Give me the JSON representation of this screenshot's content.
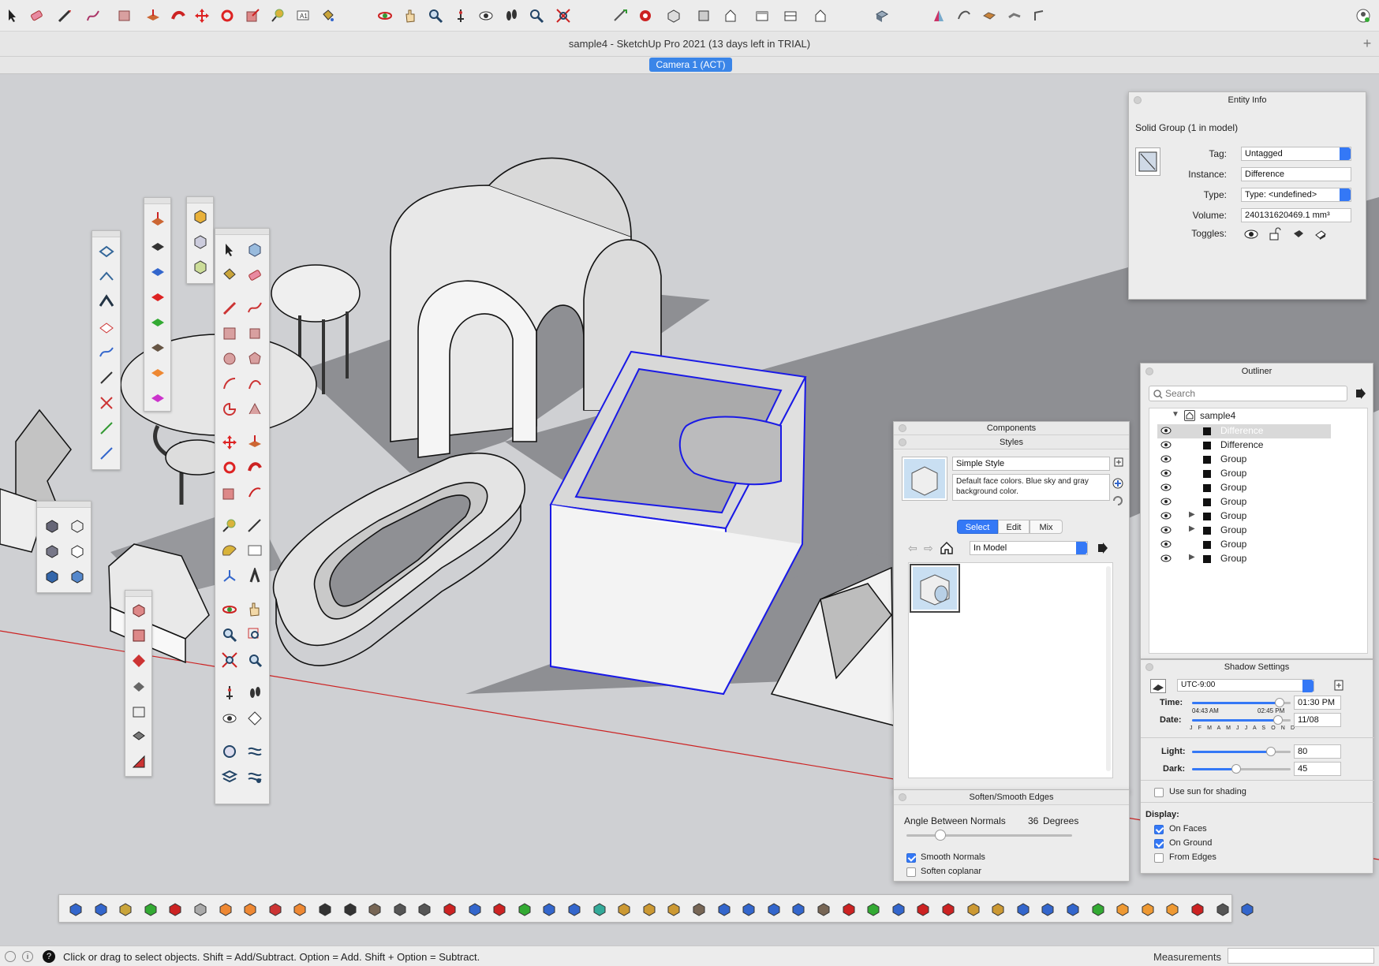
{
  "window": {
    "title": "sample4 - SketchUp Pro 2021 (13 days left in TRIAL)",
    "scene_tab": "Camera 1 (ACT)",
    "new_tab_glyph": "+"
  },
  "toolbar": {
    "icons": [
      "select-icon",
      "eraser-icon",
      "line-icon",
      "freehand-icon",
      "rectangle-icon",
      "push-pull-icon",
      "follow-me-icon",
      "move-icon",
      "rotate-icon",
      "scale-icon",
      "tape-measure-icon",
      "text-icon",
      "paint-bucket-icon",
      "orbit-icon",
      "pan-icon",
      "zoom-icon",
      "position-camera-icon",
      "look-around-icon",
      "walk-icon",
      "zoom-window-icon",
      "zoom-extents-icon",
      "section-plane-icon",
      "warehouse-icon",
      "iso-view-icon",
      "top-view-icon",
      "front-view-icon",
      "right-view-icon",
      "back-view-icon",
      "left-view-icon",
      "shaded-style-icon",
      "sandbox-icon",
      "smoove-icon",
      "stamp-icon",
      "drape-icon",
      "flip-edge-icon",
      "account-icon"
    ]
  },
  "entity_info": {
    "title": "Entity Info",
    "heading": "Solid Group (1 in model)",
    "tag_label": "Tag:",
    "tag_value": "Untagged",
    "instance_label": "Instance:",
    "instance_value": "Difference",
    "type_label": "Type:",
    "type_value": "Type: <undefined>",
    "volume_label": "Volume:",
    "volume_value": "240131620469.1 mm³",
    "toggles_label": "Toggles:"
  },
  "outliner": {
    "title": "Outliner",
    "search_placeholder": "Search",
    "root": "sample4",
    "items": [
      {
        "name": "Difference",
        "expandable": false,
        "selected": true
      },
      {
        "name": "Difference",
        "expandable": false,
        "selected": false
      },
      {
        "name": "Group",
        "expandable": false,
        "selected": false
      },
      {
        "name": "Group",
        "expandable": false,
        "selected": false
      },
      {
        "name": "Group",
        "expandable": false,
        "selected": false
      },
      {
        "name": "Group",
        "expandable": false,
        "selected": false
      },
      {
        "name": "Group",
        "expandable": true,
        "selected": false
      },
      {
        "name": "Group",
        "expandable": true,
        "selected": false
      },
      {
        "name": "Group",
        "expandable": false,
        "selected": false
      },
      {
        "name": "Group",
        "expandable": true,
        "selected": false
      }
    ]
  },
  "components": {
    "title": "Components"
  },
  "styles": {
    "title": "Styles",
    "style_name": "Simple Style",
    "description": "Default face colors. Blue sky and gray background color.",
    "tabs": [
      "Select",
      "Edit",
      "Mix"
    ],
    "active_tab": "Select",
    "collection": "In Model"
  },
  "soften": {
    "title": "Soften/Smooth Edges",
    "angle_label": "Angle Between Normals",
    "angle_value": "36",
    "angle_unit": "Degrees",
    "angle_level": 0.2,
    "smooth_normals_label": "Smooth Normals",
    "smooth_normals": true,
    "soften_coplanar_label": "Soften coplanar",
    "soften_coplanar": false
  },
  "shadow": {
    "title": "Shadow Settings",
    "timezone": "UTC-9:00",
    "time_label": "Time:",
    "time_value": "01:30 PM",
    "sunrise": "04:43 AM",
    "sunset": "02:45 PM",
    "time_level": 0.89,
    "date_label": "Date:",
    "date_value": "11/08",
    "date_level": 0.87,
    "months": "J F M A M J J A S O N D",
    "light_label": "Light:",
    "light_value": "80",
    "light_level": 0.8,
    "dark_label": "Dark:",
    "dark_value": "45",
    "dark_level": 0.45,
    "use_sun_label": "Use sun for shading",
    "use_sun": false,
    "display_label": "Display:",
    "on_faces_label": "On Faces",
    "on_faces": true,
    "on_ground_label": "On Ground",
    "on_ground": true,
    "from_edges_label": "From Edges",
    "from_edges": false
  },
  "status": {
    "message": "Click or drag to select objects. Shift = Add/Subtract. Option = Add. Shift + Option = Subtract.",
    "measurements_label": "Measurements",
    "measurements_value": ""
  },
  "colors": {
    "selection_blue": "#1a1ae6",
    "accent": "#3478f6",
    "sky_background": "#cfd0d3",
    "shadow": "#8c8d91",
    "red_axis": "#cc2222"
  }
}
